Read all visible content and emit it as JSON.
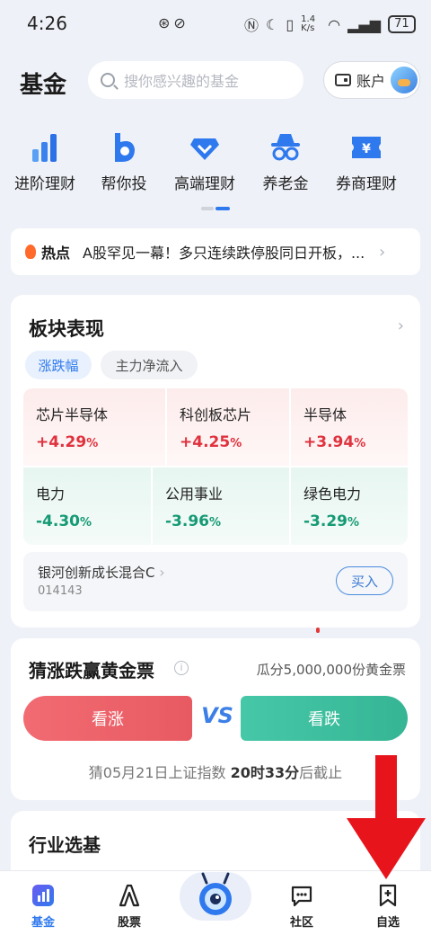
{
  "status_bar": {
    "time": "4:26",
    "net_speed": "1.4 K/s",
    "battery": "71"
  },
  "header": {
    "title": "基金",
    "search_placeholder": "搜你感兴趣的基金",
    "account_label": "账户"
  },
  "quick_nav": [
    {
      "label": "进阶理财",
      "icon": "bar-chart-icon"
    },
    {
      "label": "帮你投",
      "icon": "b-logo-icon"
    },
    {
      "label": "高端理财",
      "icon": "diamond-icon"
    },
    {
      "label": "养老金",
      "icon": "incognito-icon"
    },
    {
      "label": "券商理财",
      "icon": "ticket-yen-icon"
    }
  ],
  "news": {
    "tag": "热点",
    "text": "A股罕见一幕！多只连续跌停股同日开板，..."
  },
  "sector": {
    "title": "板块表现",
    "tabs": [
      "涨跌幅",
      "主力净流入"
    ],
    "rising": [
      {
        "name": "芯片半导体",
        "value": "+4.29",
        "unit": "%"
      },
      {
        "name": "科创板芯片",
        "value": "+4.25",
        "unit": "%"
      },
      {
        "name": "半导体",
        "value": "+3.94",
        "unit": "%"
      }
    ],
    "falling": [
      {
        "name": "电力",
        "value": "-4.30",
        "unit": "%"
      },
      {
        "name": "公用事业",
        "value": "-3.96",
        "unit": "%"
      },
      {
        "name": "绿色电力",
        "value": "-3.29",
        "unit": "%"
      }
    ],
    "fund": {
      "name": "银河创新成长混合C",
      "code": "014143",
      "buy_label": "买入"
    }
  },
  "guess": {
    "title": "猜涨跌赢黄金票",
    "prize": "瓜分5,000,000份黄金票",
    "up_label": "看涨",
    "down_label": "看跌",
    "vs": "VS",
    "deadline_prefix": "猜05月21日上证指数",
    "deadline_time": "20时33分",
    "deadline_suffix": "后截止"
  },
  "industry": {
    "title": "行业选基"
  },
  "tabbar": [
    {
      "label": "基金",
      "icon": "chart-icon"
    },
    {
      "label": "股票",
      "icon": "stock-a-icon"
    },
    {
      "label": "",
      "icon": "mascot-icon"
    },
    {
      "label": "社区",
      "icon": "chat-icon"
    },
    {
      "label": "自选",
      "icon": "bookmark-plus-icon"
    }
  ],
  "colors": {
    "accent": "#3a7bd5",
    "rise": "#e0323e",
    "fall": "#159a74"
  }
}
